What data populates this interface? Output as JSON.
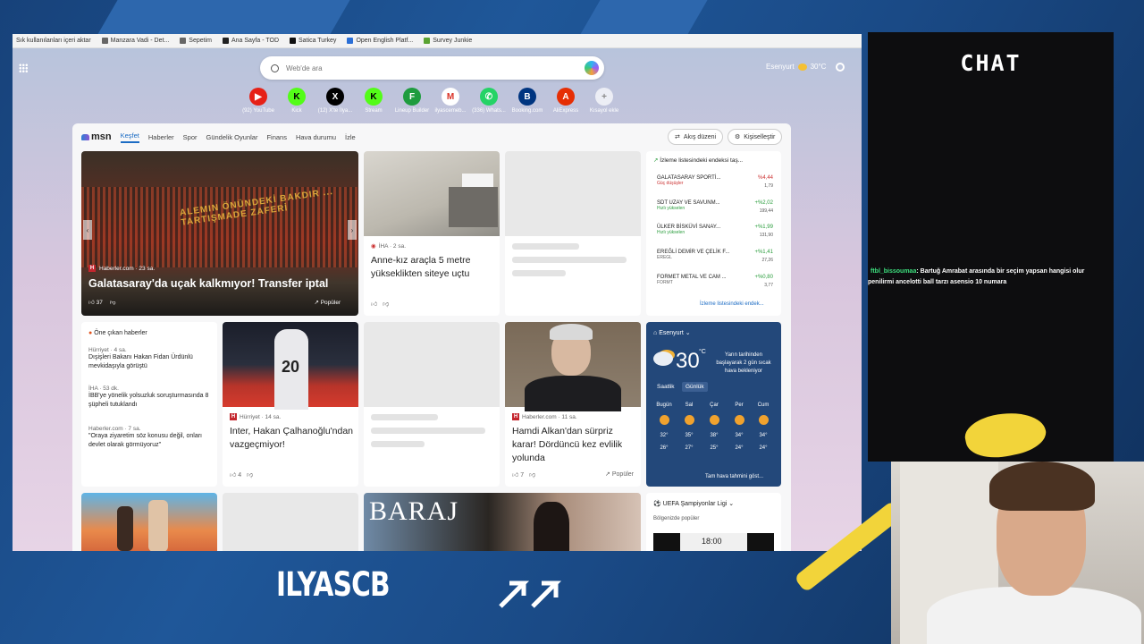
{
  "bookmarks": [
    "Sık kullanılanları içeri aktar",
    "Manzara Vadi - Det...",
    "Sepetim",
    "Ana Sayfa - TOD",
    "Satica Turkey",
    "Open English Platf...",
    "Survey Junkie"
  ],
  "search": {
    "placeholder": "Web'de ara"
  },
  "weather_top": {
    "city": "Esenyurt",
    "temp": "30°C"
  },
  "quicklinks": [
    {
      "label": "(92) YouTube",
      "glyph": "▶",
      "color": "#e62117"
    },
    {
      "label": "Kick",
      "glyph": "K",
      "color": "#53fc18"
    },
    {
      "label": "(12) X'te İlya...",
      "glyph": "X",
      "color": "#000000"
    },
    {
      "label": "Stream",
      "glyph": "K",
      "color": "#53fc18"
    },
    {
      "label": "Lineup Builder",
      "glyph": "F",
      "color": "#1f9c3f"
    },
    {
      "label": "ilyascemeb...",
      "glyph": "M",
      "color": "#d93025"
    },
    {
      "label": "(336) Whats...",
      "glyph": "✆",
      "color": "#25d366"
    },
    {
      "label": "Booking.com",
      "glyph": "B",
      "color": "#003580"
    },
    {
      "label": "AliExpress",
      "glyph": "A",
      "color": "#e62e04"
    },
    {
      "label": "Kısayol ekle",
      "glyph": "+",
      "color": "#888888"
    }
  ],
  "msn": {
    "logo": "msn",
    "tabs": [
      "Keşfet",
      "Haberler",
      "Spor",
      "Gündelik Oyunlar",
      "Finans",
      "Hava durumu",
      "İzle"
    ],
    "layout_btn": "Akış düzeni",
    "personalize_btn": "Kişiselleştir"
  },
  "hero": {
    "source": "Haberler.com · 23 sa.",
    "title": "Galatasaray'da uçak kalkmıyor! Transfer iptal",
    "banner": "ALEMIN ÖNÜNDEKİ BAKDIR ... TARTIŞMADE ZAFERİ",
    "likes": "37",
    "popular": "Popüler"
  },
  "card2": {
    "source": "İHA · 2 sa.",
    "title": "Anne-kız araçla 5 metre yükseklikten siteye uçtu"
  },
  "watchlist": {
    "title": "İzleme listesindeki endeksi taş...",
    "rows": [
      {
        "name": "GALATASARAY SPORTİ...",
        "sub": "Güç düşüşler",
        "pct": "%4,44",
        "val": "1,79"
      },
      {
        "name": "SDT UZAY VE SAVUNM...",
        "sub": "Hızlı yükselen",
        "pct": "+%2,02",
        "val": "199,44"
      },
      {
        "name": "ÜLKER BİSKÜVİ SANAY...",
        "sub": "Hızlı yükselen",
        "pct": "+%1,99",
        "val": "131,90"
      },
      {
        "name": "EREĞLİ DEMİR VE ÇELİK F...",
        "sub": "EREGL",
        "pct": "+%1,41",
        "val": "27,26"
      },
      {
        "name": "FORMET METAL VE CAM ...",
        "sub": "FORMT",
        "pct": "+%0,80",
        "val": "3,77"
      }
    ],
    "more": "İzleme listesindeki endek..."
  },
  "topnews": {
    "title": "Öne çıkan haberler",
    "items": [
      {
        "source": "Hürriyet · 4 sa.",
        "text": "Dışişleri Bakanı Hakan Fidan Ürdünlü mevkidaşıyla görüştü"
      },
      {
        "source": "İHA · 53 dk.",
        "text": "İBB'ye yönelik yolsuzluk soruşturmasında 8 şüpheli tutuklandı"
      },
      {
        "source": "Haberler.com · 7 sa.",
        "text": "\"Oraya ziyaretim söz konusu değil, onları devlet olarak görmüyoruz\""
      }
    ]
  },
  "card_inter": {
    "source": "Hürriyet · 14 sa.",
    "title": "Inter, Hakan Çalhanoğlu'ndan vazgeçmiyor!",
    "likes": "4",
    "jersey": "20"
  },
  "card_hamdi": {
    "source": "Haberler.com · 11 sa.",
    "title": "Hamdi Alkan'dan sürpriz karar! Dördüncü kez evlilik yolunda",
    "likes": "7",
    "popular": "Popüler"
  },
  "weather": {
    "city": "Esenyurt",
    "temp": "30",
    "unit": "°C",
    "note": "Yarın tarihinden başlayarak 2 gün sıcak hava bekleniyor",
    "tabs": [
      "Saatlik",
      "Günlük"
    ],
    "days": [
      {
        "name": "Bugün",
        "hi": "32°",
        "lo": "26°"
      },
      {
        "name": "Sal",
        "hi": "35°",
        "lo": "27°"
      },
      {
        "name": "Çar",
        "hi": "38°",
        "lo": "25°"
      },
      {
        "name": "Per",
        "hi": "34°",
        "lo": "24°"
      },
      {
        "name": "Cum",
        "hi": "34°",
        "lo": "24°"
      }
    ],
    "forecast_link": "Tam hava tahmini göst..."
  },
  "uefa": {
    "title": "UEFA Şampiyonlar Ligi",
    "sub": "Bölgenizde popüler",
    "time": "18:00"
  },
  "baraj": {
    "text": "BARAJ"
  },
  "chat": {
    "title": "CHAT",
    "user": "ftbl_bissoumaa",
    "message": ": Bartuğ Amrabat arasında bir seçim yapsan hangisi olur",
    "message2": "penilirmi ancelotti ball tarzı asensio 10 numara"
  },
  "brand": {
    "name": "ILYASCB"
  }
}
